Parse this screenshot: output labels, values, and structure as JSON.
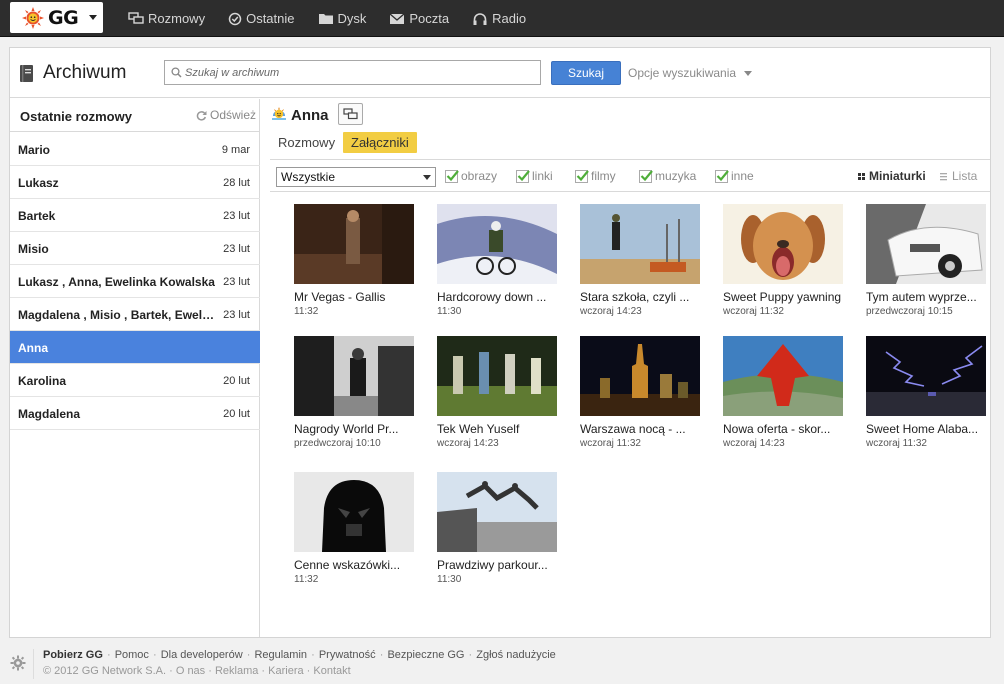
{
  "topbar": {
    "logo_text": "GG",
    "nav": [
      {
        "label": "Rozmowy",
        "icon": "chat-icon"
      },
      {
        "label": "Ostatnie",
        "icon": "check-circle-icon"
      },
      {
        "label": "Dysk",
        "icon": "folder-icon"
      },
      {
        "label": "Poczta",
        "icon": "envelope-icon"
      },
      {
        "label": "Radio",
        "icon": "headphones-icon"
      }
    ]
  },
  "header": {
    "title": "Archiwum",
    "search_placeholder": "Szukaj w archiwum",
    "search_button": "Szukaj",
    "search_options": "Opcje wyszukiwania"
  },
  "sidebar": {
    "title": "Ostatnie rozmowy",
    "refresh_label": "Odśwież",
    "conversations": [
      {
        "name": "Mario",
        "date": "9 mar",
        "active": false
      },
      {
        "name": "Lukasz",
        "date": "28 lut",
        "active": false
      },
      {
        "name": "Bartek",
        "date": "23 lut",
        "active": false
      },
      {
        "name": "Misio",
        "date": "23 lut",
        "active": false
      },
      {
        "name": "Lukasz , Anna, Ewelinka Kowalska",
        "date": "23 lut",
        "active": false
      },
      {
        "name": "Magdalena , Misio , Bartek, Ewelinka",
        "date": "23 lut",
        "active": false
      },
      {
        "name": "Anna",
        "date": "",
        "active": true
      },
      {
        "name": "Karolina",
        "date": "20 lut",
        "active": false
      },
      {
        "name": "Magdalena",
        "date": "20 lut",
        "active": false
      }
    ]
  },
  "content": {
    "user_name": "Anna",
    "tabs": {
      "conversations": "Rozmowy",
      "attachments": "Załączniki"
    },
    "filter": {
      "selected": "Wszystkie",
      "checks": [
        "obrazy",
        "linki",
        "filmy",
        "muzyka",
        "inne"
      ]
    },
    "view": {
      "thumbnails": "Miniaturki",
      "list": "Lista"
    },
    "items": [
      {
        "title": "Mr Vegas - Gallis",
        "time": "11:32",
        "colors": [
          "#3a2417",
          "#8a5a3a"
        ]
      },
      {
        "title": "Hardcorowy down ...",
        "time": "11:30",
        "colors": [
          "#6f7aa6",
          "#e5e6f0"
        ]
      },
      {
        "title": "Stara szkoła, czyli ...",
        "time": "wczoraj 14:23",
        "colors": [
          "#8fb0cc",
          "#c7a36f"
        ]
      },
      {
        "title": "Sweet Puppy yawning",
        "time": "wczoraj 11:32",
        "colors": [
          "#f5efe0",
          "#c88449"
        ]
      },
      {
        "title": "Tym autem wyprze...",
        "time": "przedwczoraj 10:15",
        "colors": [
          "#eeeeee",
          "#9a9a9a"
        ]
      },
      {
        "title": "Nagrody World Pr...",
        "time": "przedwczoraj 10:10",
        "colors": [
          "#d8d8d8",
          "#1e1e1e"
        ]
      },
      {
        "title": "Tek Weh Yuself",
        "time": "wczoraj 14:23",
        "colors": [
          "#1f2a18",
          "#6f8d3f"
        ]
      },
      {
        "title": "Warszawa nocą - ...",
        "time": "wczoraj 11:32",
        "colors": [
          "#0a0c18",
          "#d28f2c"
        ]
      },
      {
        "title": "Nowa oferta - skor...",
        "time": "wczoraj 14:23",
        "colors": [
          "#3a7ab8",
          "#6f9a5f"
        ]
      },
      {
        "title": "Sweet Home Alaba...",
        "time": "wczoraj 11:32",
        "colors": [
          "#0a0a12",
          "#6a6ac8"
        ]
      },
      {
        "title": "Cenne wskazówki...",
        "time": "11:32",
        "colors": [
          "#e8e8e8",
          "#0a0a0a"
        ]
      },
      {
        "title": "Prawdziwy parkour...",
        "time": "11:30",
        "colors": [
          "#d6e2ee",
          "#3b3b3b"
        ]
      }
    ]
  },
  "footer": {
    "links": [
      "Pobierz GG",
      "Pomoc",
      "Dla developerów",
      "Regulamin",
      "Prywatność",
      "Bezpieczne GG",
      "Zgłoś nadużycie"
    ],
    "copyright": "© 2012 GG Network S.A.",
    "secondary": [
      "O nas",
      "Reklama",
      "Kariera",
      "Kontakt"
    ]
  },
  "colors": {
    "accent": "#4a82dd",
    "highlight": "#f2cd43",
    "topbar": "#2d2d2d",
    "check": "#4fae3a"
  }
}
